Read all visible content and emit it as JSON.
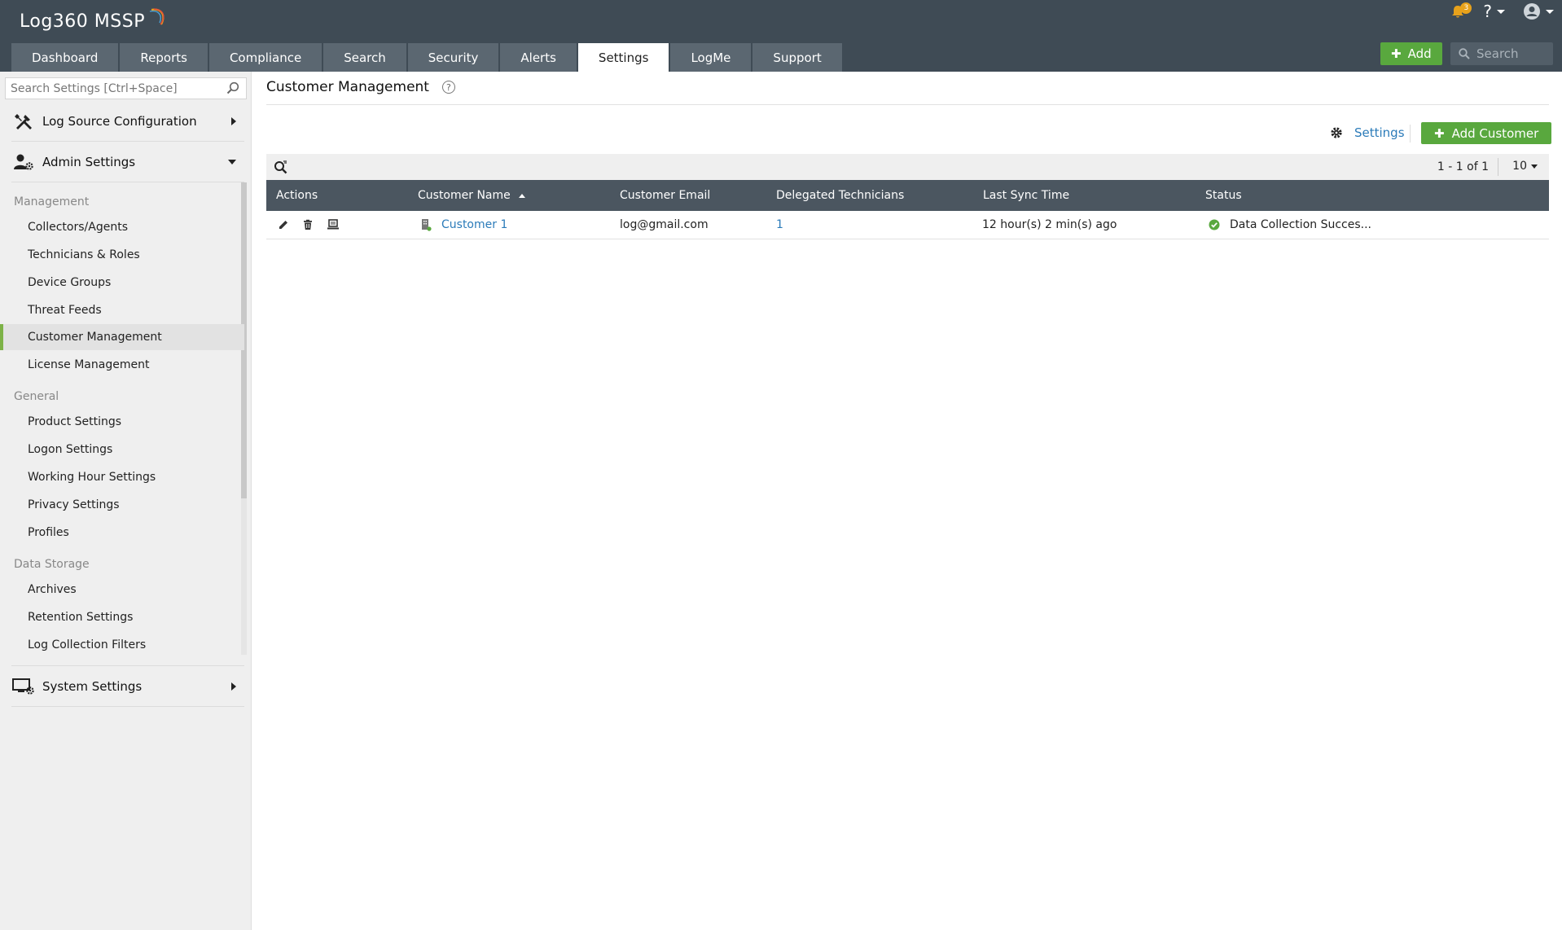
{
  "app": {
    "logo_text": "Log360 MSSP"
  },
  "nav": {
    "tabs": [
      {
        "label": "Dashboard"
      },
      {
        "label": "Reports"
      },
      {
        "label": "Compliance"
      },
      {
        "label": "Search"
      },
      {
        "label": "Security"
      },
      {
        "label": "Alerts"
      },
      {
        "label": "Settings",
        "active": true
      },
      {
        "label": "LogMe"
      },
      {
        "label": "Support"
      }
    ]
  },
  "header": {
    "notification_count": "3",
    "help_label": "?",
    "add_label": "Add",
    "search_placeholder": "Search"
  },
  "sidebar": {
    "search_placeholder": "Search Settings [Ctrl+Space]",
    "sections": [
      {
        "label": "Log Source Configuration",
        "icon": "tools-icon"
      },
      {
        "label": "Admin Settings",
        "icon": "admin-user-gear-icon"
      },
      {
        "label": "System Settings",
        "icon": "monitor-gear-icon"
      }
    ],
    "groups": [
      {
        "label": "Management",
        "items": [
          "Collectors/Agents",
          "Technicians & Roles",
          "Device Groups",
          "Threat Feeds",
          "Customer Management",
          "License Management"
        ]
      },
      {
        "label": "General",
        "items": [
          "Product Settings",
          "Logon Settings",
          "Working Hour Settings",
          "Privacy Settings",
          "Profiles"
        ]
      },
      {
        "label": "Data Storage",
        "items": [
          "Archives",
          "Retention Settings",
          "Log Collection Filters"
        ]
      }
    ],
    "active_item": "Customer Management"
  },
  "main": {
    "title": "Customer Management",
    "settings_label": "Settings",
    "add_customer_label": "Add Customer",
    "pager_text": "1 - 1 of 1",
    "per_page": "10"
  },
  "table": {
    "columns": [
      "Actions",
      "Customer Name",
      "Customer Email",
      "Delegated Technicians",
      "Last Sync Time",
      "Status"
    ],
    "sort_column": "Customer Name",
    "sort_direction": "ascending",
    "rows": [
      {
        "name": "Customer 1",
        "email": "log@gmail.com",
        "technicians": "1",
        "last_sync": "12 hour(s) 2 min(s) ago",
        "status": "Data Collection Succes...",
        "status_color": "#59a83e"
      }
    ]
  },
  "colors": {
    "header_bg": "#3f4b55",
    "accent_green": "#59a83e",
    "link_blue": "#2b7bb9",
    "table_header_bg": "#4b5660"
  }
}
